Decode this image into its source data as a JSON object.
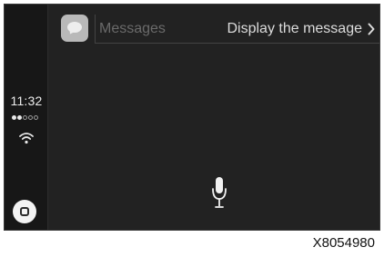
{
  "status_bar": {
    "time": "11:32",
    "signal_strength": 2,
    "signal_total": 5,
    "wifi_icon": "wifi-icon",
    "home_icon": "home-button-icon"
  },
  "header": {
    "app_icon": "messages-icon",
    "app_title": "Messages",
    "action_label": "Display the message",
    "action_icon": "chevron-right-icon"
  },
  "main": {
    "mic_icon": "microphone-icon"
  },
  "caption": {
    "ref_code": "X8054980"
  },
  "colors": {
    "screen_bg": "#222222",
    "sidebar_bg": "#171717",
    "text_light": "#dcdcdc",
    "text_dim": "#6a6a6a"
  }
}
